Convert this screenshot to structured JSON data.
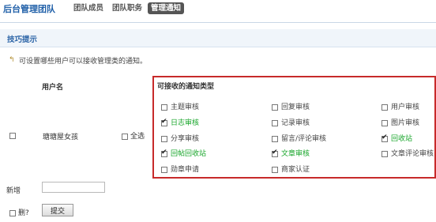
{
  "header": {
    "title": "后台管理团队",
    "tabs": [
      "团队成员",
      "团队职务",
      "管理通知"
    ]
  },
  "section": {
    "title": "技巧提示",
    "tip": "可设置哪些用户可以接收管理类的通知。"
  },
  "table": {
    "user_column": "用户名",
    "notify_title": "可接收的通知类型",
    "username": "瑭瑭屋女孩",
    "select_all": "全选",
    "options": [
      {
        "label": "主题审核",
        "checked": false,
        "highlight": false
      },
      {
        "label": "回复审核",
        "checked": false,
        "highlight": false
      },
      {
        "label": "用户审核",
        "checked": false,
        "highlight": false
      },
      {
        "label": "日志审核",
        "checked": true,
        "highlight": true
      },
      {
        "label": "记录审核",
        "checked": false,
        "highlight": false
      },
      {
        "label": "图片审核",
        "checked": false,
        "highlight": false
      },
      {
        "label": "分享审核",
        "checked": false,
        "highlight": false
      },
      {
        "label": "留言/评论审核",
        "checked": false,
        "highlight": false
      },
      {
        "label": "回收站",
        "checked": true,
        "highlight": true
      },
      {
        "label": "回帖回收站",
        "checked": true,
        "highlight": true
      },
      {
        "label": "文章审核",
        "checked": true,
        "highlight": true
      },
      {
        "label": "文章评论审核",
        "checked": false,
        "highlight": false
      },
      {
        "label": "勋章申请",
        "checked": false,
        "highlight": false
      },
      {
        "label": "商家认证",
        "checked": false,
        "highlight": false
      }
    ]
  },
  "form": {
    "add_label": "新增",
    "add_value": "",
    "delete_label": "删?",
    "submit_label": "提交"
  },
  "colors": {
    "accent": "#1f5fa8",
    "highlight_border": "#c72a2a",
    "green_label": "#19a62b"
  }
}
